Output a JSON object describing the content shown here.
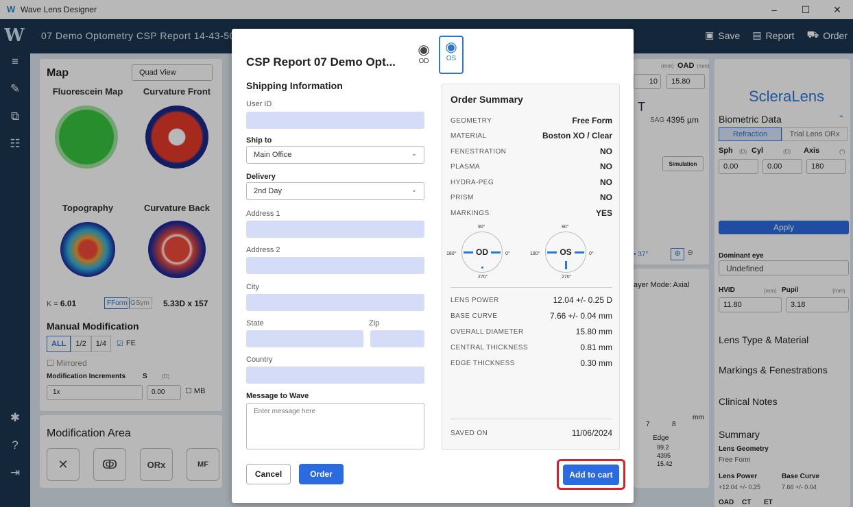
{
  "window": {
    "title": "Wave Lens Designer",
    "controls": [
      "–",
      "☐",
      "✕"
    ]
  },
  "header": {
    "title": "07 Demo Optometry CSP Report  14-43-50",
    "actions": [
      {
        "label": "Save",
        "icon": "save-icon"
      },
      {
        "label": "Report",
        "icon": "report-icon"
      },
      {
        "label": "Order",
        "icon": "cart-icon"
      }
    ]
  },
  "map_panel": {
    "title": "Map",
    "view_select": "Quad View",
    "cells": [
      "Fluorescein Map",
      "Curvature Front",
      "Topography",
      "Curvature Back"
    ],
    "k_label": "K = ",
    "k_value": "6.01",
    "fform": "FForm",
    "gsym": "GSym",
    "dims": "5.33D x 157",
    "manual_mod": "Manual Modification",
    "segments": [
      "ALL",
      "1/2",
      "1/4"
    ],
    "fe": "FE",
    "mirrored": "Mirrored",
    "mod_inc": "Modification Increments",
    "s_label": "S",
    "s_unit": "(D)",
    "inc_value": "1x",
    "s_value": "0.00",
    "mb": "MB"
  },
  "mod_area": {
    "title": "Modification Area",
    "buttons": [
      "✕",
      "ↂ",
      "ORx",
      "MF"
    ]
  },
  "middle_bg": {
    "oad_label": "OAD",
    "mm1": "(mm)",
    "mm2": "(mm)",
    "oad_partial": "10",
    "oad_value": "15.80",
    "t": "T",
    "sag": "SAG",
    "sag_value": "4395 µm",
    "simulation": "Simulation",
    "angle": "• 37°",
    "layer_mode": "ayer Mode: Axial",
    "axis7": "7",
    "axis8": "8",
    "mm_axis": "mm",
    "edge_title": "Edge",
    "edge_values": [
      "99.2",
      "4395",
      "15.42"
    ]
  },
  "right_panel": {
    "brand": "ScleraLens",
    "biometric": "Biometric Data",
    "tabs": [
      "Refraction",
      "Trial Lens ORx"
    ],
    "sph": "Sph",
    "cyl": "Cyl",
    "axis": "Axis",
    "d1": "(D)",
    "d2": "(D)",
    "deg": "(°)",
    "sph_v": "0.00",
    "cyl_v": "0.00",
    "axis_v": "180",
    "apply": "Apply",
    "dominant": "Dominant eye",
    "dominant_v": "Undefined",
    "hvid": "HVID",
    "mm3": "(mm)",
    "pupil": "Pupil",
    "mm4": "(mm)",
    "hvid_v": "11.80",
    "pupil_v": "3.18",
    "sections": [
      "Lens Type & Material",
      "Markings & Fenestrations",
      "Clinical Notes"
    ],
    "summary": "Summary",
    "lens_geometry": "Lens Geometry",
    "lens_geometry_v": "Free Form",
    "lens_power": "Lens Power",
    "base_curve": "Base Curve",
    "lens_power_v": "+12.04 +/- 0.25",
    "base_curve_v": "7.66 +/- 0.04",
    "oad": "OAD",
    "ct": "CT",
    "et": "ET"
  },
  "modal": {
    "title": "CSP Report 07 Demo Opt...",
    "eye_od": "OD",
    "eye_os": "OS",
    "shipping_title": "Shipping Information",
    "user_id_label": "User ID",
    "ship_to_label": "Ship to",
    "ship_to_value": "Main Office",
    "delivery_label": "Delivery",
    "delivery_value": "2nd Day",
    "address1_label": "Address 1",
    "address2_label": "Address 2",
    "city_label": "City",
    "state_label": "State",
    "zip_label": "Zip",
    "country_label": "Country",
    "message_label": "Message to Wave",
    "message_placeholder": "Enter message here",
    "cancel": "Cancel",
    "order": "Order",
    "add_to_cart": "Add to cart"
  },
  "order_summary": {
    "title": "Order Summary",
    "rows": [
      {
        "k": "GEOMETRY",
        "v": "Free Form"
      },
      {
        "k": "MATERIAL",
        "v": "Boston XO / Clear"
      },
      {
        "k": "FENESTRATION",
        "v": "NO"
      },
      {
        "k": "PLASMA",
        "v": "NO"
      },
      {
        "k": "HYDRA-PEG",
        "v": "NO"
      },
      {
        "k": "PRISM",
        "v": "NO"
      },
      {
        "k": "MARKINGS",
        "v": "YES"
      }
    ],
    "dial_od": {
      "label": "OD",
      "top": "90°",
      "left": "180°",
      "right": "0°",
      "bottom": "270°"
    },
    "dial_os": {
      "label": "OS",
      "top": "90°",
      "left": "180°",
      "right": "0°",
      "bottom": "270°"
    },
    "measures": [
      {
        "k": "LENS POWER",
        "v": "12.04 +/- 0.25 D"
      },
      {
        "k": "BASE CURVE",
        "v": "7.66 +/- 0.04 mm"
      },
      {
        "k": "OVERALL DIAMETER",
        "v": "15.80 mm"
      },
      {
        "k": "CENTRAL THICKNESS",
        "v": "0.81 mm"
      },
      {
        "k": "EDGE THICKNESS",
        "v": "0.30 mm"
      }
    ],
    "saved_on_label": "SAVED ON",
    "saved_on_value": "11/06/2024"
  },
  "colors": {
    "accent": "#2a6be0",
    "header": "#1c3550",
    "input_fill": "#d5dcf7",
    "highlight": "#d6222b"
  }
}
